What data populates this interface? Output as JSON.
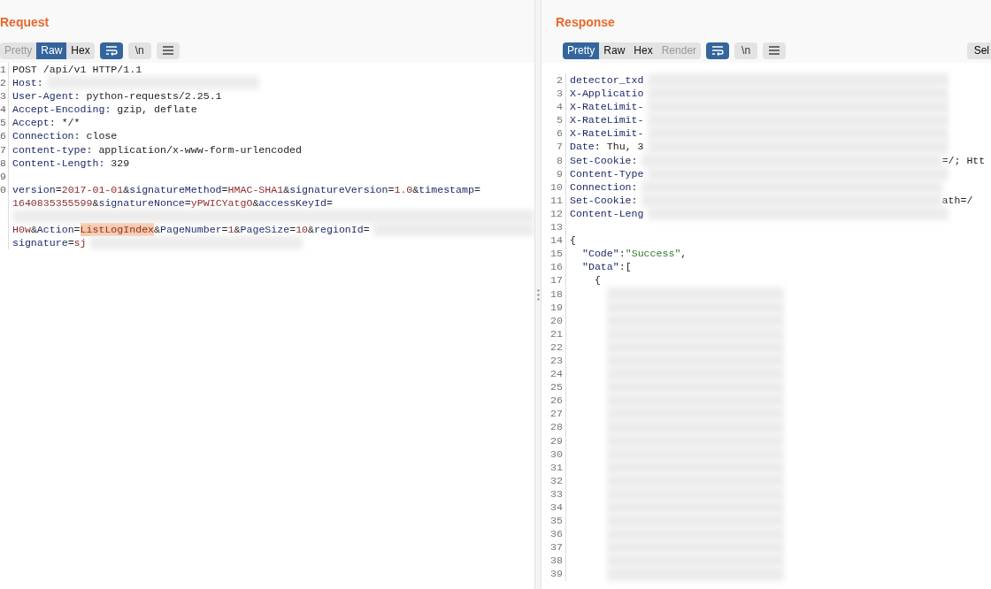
{
  "request": {
    "title": "Request",
    "views": [
      {
        "label": "Pretty",
        "selected": false,
        "disabled": true
      },
      {
        "label": "Raw",
        "selected": true,
        "disabled": false
      },
      {
        "label": "Hex",
        "selected": false,
        "disabled": false
      }
    ],
    "wrap": {
      "on": true
    },
    "newline_label": "\\n",
    "lines": [
      {
        "number": "1",
        "segments": [
          {
            "kind": "plain",
            "text": "POST /api/v1 HTTP/1.1"
          }
        ]
      },
      {
        "number": "2",
        "segments": [
          {
            "kind": "key",
            "text": "Host"
          },
          {
            "kind": "plain",
            "text": ":"
          },
          {
            "kind": "redacted"
          }
        ]
      },
      {
        "number": "3",
        "segments": [
          {
            "kind": "key",
            "text": "User-Agent"
          },
          {
            "kind": "plain",
            "text": ": python-requests/2.25.1"
          }
        ]
      },
      {
        "number": "4",
        "segments": [
          {
            "kind": "key",
            "text": "Accept-Encoding"
          },
          {
            "kind": "plain",
            "text": ": gzip, deflate"
          }
        ]
      },
      {
        "number": "5",
        "segments": [
          {
            "kind": "key",
            "text": "Accept"
          },
          {
            "kind": "plain",
            "text": ": */*"
          }
        ]
      },
      {
        "number": "6",
        "segments": [
          {
            "kind": "key",
            "text": "Connection"
          },
          {
            "kind": "plain",
            "text": ": close"
          }
        ]
      },
      {
        "number": "7",
        "segments": [
          {
            "kind": "key",
            "text": "content-type"
          },
          {
            "kind": "plain",
            "text": ": application/x-www-form-urlencoded"
          }
        ]
      },
      {
        "number": "8",
        "segments": [
          {
            "kind": "key",
            "text": "Content-Length"
          },
          {
            "kind": "plain",
            "text": ": 329"
          }
        ]
      },
      {
        "number": "9"
      },
      {
        "number": "0",
        "segments": [
          {
            "kind": "key",
            "text": "version"
          },
          {
            "kind": "plain",
            "text": "="
          },
          {
            "kind": "value",
            "text": "2017-01-01"
          },
          {
            "kind": "plain",
            "text": "&"
          },
          {
            "kind": "key",
            "text": "signatureMethod"
          },
          {
            "kind": "plain",
            "text": "="
          },
          {
            "kind": "value",
            "text": "HMAC-SHA1"
          },
          {
            "kind": "plain",
            "text": "&"
          },
          {
            "kind": "key",
            "text": "signatureVersion"
          },
          {
            "kind": "plain",
            "text": "="
          },
          {
            "kind": "value",
            "text": "1.0"
          },
          {
            "kind": "plain",
            "text": "&"
          },
          {
            "kind": "key",
            "text": "timestamp"
          },
          {
            "kind": "plain",
            "text": "="
          },
          {
            "kind": "wrap"
          },
          {
            "kind": "value",
            "text": "1640835355599"
          },
          {
            "kind": "plain",
            "text": "&"
          },
          {
            "kind": "key",
            "text": "signatureNonce"
          },
          {
            "kind": "plain",
            "text": "="
          },
          {
            "kind": "value",
            "text": "yPWICYatgO"
          },
          {
            "kind": "plain",
            "text": "&"
          },
          {
            "kind": "key",
            "text": "accessKeyId"
          },
          {
            "kind": "plain",
            "text": "="
          },
          {
            "kind": "wrap"
          },
          {
            "kind": "redacted"
          },
          {
            "kind": "wrap"
          },
          {
            "kind": "value",
            "text": "H0w"
          },
          {
            "kind": "plain",
            "text": "&"
          },
          {
            "kind": "key",
            "text": "Action"
          },
          {
            "kind": "plain",
            "text": "="
          },
          {
            "kind": "highlight",
            "text": "ListLogIndex"
          },
          {
            "kind": "plain",
            "text": "&"
          },
          {
            "kind": "key",
            "text": "PageNumber"
          },
          {
            "kind": "plain",
            "text": "="
          },
          {
            "kind": "value",
            "text": "1"
          },
          {
            "kind": "plain",
            "text": "&"
          },
          {
            "kind": "key",
            "text": "PageSize"
          },
          {
            "kind": "plain",
            "text": "="
          },
          {
            "kind": "value",
            "text": "10"
          },
          {
            "kind": "plain",
            "text": "&"
          },
          {
            "kind": "key",
            "text": "regionId"
          },
          {
            "kind": "plain",
            "text": "="
          },
          {
            "kind": "redacted"
          },
          {
            "kind": "wrap"
          },
          {
            "kind": "key",
            "text": "signature"
          },
          {
            "kind": "plain",
            "text": "="
          },
          {
            "kind": "value",
            "text": "sj"
          },
          {
            "kind": "redacted"
          }
        ]
      }
    ]
  },
  "response": {
    "title": "Response",
    "views": [
      {
        "label": "Pretty",
        "selected": true,
        "disabled": false
      },
      {
        "label": "Raw",
        "selected": false,
        "disabled": false
      },
      {
        "label": "Hex",
        "selected": false,
        "disabled": false
      },
      {
        "label": "Render",
        "selected": false,
        "disabled": true
      }
    ],
    "wrap": {
      "on": true
    },
    "newline_label": "\\n",
    "select_label": "Sel",
    "lines": [
      {
        "number": "2",
        "segments": [
          {
            "kind": "key",
            "text": "detector_txd"
          },
          {
            "kind": "redacted"
          }
        ]
      },
      {
        "number": "3",
        "segments": [
          {
            "kind": "key",
            "text": "X-Applicatio"
          },
          {
            "kind": "redacted"
          }
        ]
      },
      {
        "number": "4",
        "segments": [
          {
            "kind": "key",
            "text": "X-RateLimit-"
          },
          {
            "kind": "redacted"
          }
        ]
      },
      {
        "number": "5",
        "segments": [
          {
            "kind": "key",
            "text": "X-RateLimit-"
          },
          {
            "kind": "redacted"
          }
        ]
      },
      {
        "number": "6",
        "segments": [
          {
            "kind": "key",
            "text": "X-RateLimit-"
          },
          {
            "kind": "redacted"
          }
        ]
      },
      {
        "number": "7",
        "segments": [
          {
            "kind": "key",
            "text": "Date"
          },
          {
            "kind": "plain",
            "text": ": Thu, 3"
          },
          {
            "kind": "redacted"
          }
        ]
      },
      {
        "number": "8",
        "segments": [
          {
            "kind": "key",
            "text": "Set-Cookie"
          },
          {
            "kind": "plain",
            "text": ":"
          },
          {
            "kind": "redacted"
          },
          {
            "kind": "plain",
            "text": "=/; Htt"
          }
        ]
      },
      {
        "number": "9",
        "segments": [
          {
            "kind": "key",
            "text": "Content-Type"
          },
          {
            "kind": "redacted"
          }
        ]
      },
      {
        "number": "10",
        "segments": [
          {
            "kind": "key",
            "text": "Connection"
          },
          {
            "kind": "plain",
            "text": ":"
          },
          {
            "kind": "redacted"
          }
        ]
      },
      {
        "number": "11",
        "segments": [
          {
            "kind": "key",
            "text": "Set-Cookie"
          },
          {
            "kind": "plain",
            "text": ":"
          },
          {
            "kind": "redacted"
          },
          {
            "kind": "plain",
            "text": "ath=/"
          }
        ]
      },
      {
        "number": "12",
        "segments": [
          {
            "kind": "key",
            "text": "Content-Leng"
          },
          {
            "kind": "redacted"
          }
        ]
      },
      {
        "number": "13"
      },
      {
        "number": "14",
        "segments": [
          {
            "kind": "plain",
            "text": "{"
          }
        ]
      },
      {
        "number": "15",
        "segments": [
          {
            "kind": "indent"
          },
          {
            "kind": "key",
            "text": "\"Code\""
          },
          {
            "kind": "plain",
            "text": ":"
          },
          {
            "kind": "string",
            "text": "\"Success\""
          },
          {
            "kind": "plain",
            "text": ","
          }
        ]
      },
      {
        "number": "16",
        "segments": [
          {
            "kind": "indent"
          },
          {
            "kind": "key",
            "text": "\"Data\""
          },
          {
            "kind": "plain",
            "text": ":["
          }
        ]
      },
      {
        "number": "17",
        "segments": [
          {
            "kind": "indent"
          },
          {
            "kind": "indent"
          },
          {
            "kind": "plain",
            "text": "{"
          }
        ]
      },
      {
        "number": "18",
        "segments": [
          {
            "kind": "indent"
          },
          {
            "kind": "indent"
          },
          {
            "kind": "indent"
          },
          {
            "kind": "redacted"
          }
        ]
      },
      {
        "number": "19",
        "segments": [
          {
            "kind": "indent"
          },
          {
            "kind": "indent"
          },
          {
            "kind": "indent"
          },
          {
            "kind": "redacted"
          }
        ]
      },
      {
        "number": "20",
        "segments": [
          {
            "kind": "indent"
          },
          {
            "kind": "indent"
          },
          {
            "kind": "indent"
          },
          {
            "kind": "redacted"
          }
        ]
      },
      {
        "number": "21",
        "segments": [
          {
            "kind": "indent"
          },
          {
            "kind": "indent"
          },
          {
            "kind": "indent"
          },
          {
            "kind": "redacted"
          }
        ]
      },
      {
        "number": "22",
        "segments": [
          {
            "kind": "indent"
          },
          {
            "kind": "indent"
          },
          {
            "kind": "indent"
          },
          {
            "kind": "redacted"
          }
        ]
      },
      {
        "number": "23",
        "segments": [
          {
            "kind": "indent"
          },
          {
            "kind": "indent"
          },
          {
            "kind": "indent"
          },
          {
            "kind": "redacted"
          }
        ]
      },
      {
        "number": "24",
        "segments": [
          {
            "kind": "indent"
          },
          {
            "kind": "indent"
          },
          {
            "kind": "indent"
          },
          {
            "kind": "redacted"
          }
        ]
      },
      {
        "number": "25",
        "segments": [
          {
            "kind": "indent"
          },
          {
            "kind": "indent"
          },
          {
            "kind": "indent"
          },
          {
            "kind": "redacted"
          }
        ]
      },
      {
        "number": "26",
        "segments": [
          {
            "kind": "indent"
          },
          {
            "kind": "indent"
          },
          {
            "kind": "indent"
          },
          {
            "kind": "redacted"
          }
        ]
      },
      {
        "number": "27",
        "segments": [
          {
            "kind": "indent"
          },
          {
            "kind": "indent"
          },
          {
            "kind": "indent"
          },
          {
            "kind": "redacted"
          }
        ]
      },
      {
        "number": "28",
        "segments": [
          {
            "kind": "indent"
          },
          {
            "kind": "indent"
          },
          {
            "kind": "indent"
          },
          {
            "kind": "redacted"
          }
        ]
      },
      {
        "number": "29",
        "segments": [
          {
            "kind": "indent"
          },
          {
            "kind": "indent"
          },
          {
            "kind": "indent"
          },
          {
            "kind": "redacted"
          }
        ]
      },
      {
        "number": "30",
        "segments": [
          {
            "kind": "indent"
          },
          {
            "kind": "indent"
          },
          {
            "kind": "indent"
          },
          {
            "kind": "redacted"
          }
        ]
      },
      {
        "number": "31",
        "segments": [
          {
            "kind": "indent"
          },
          {
            "kind": "indent"
          },
          {
            "kind": "indent"
          },
          {
            "kind": "redacted"
          }
        ]
      },
      {
        "number": "32",
        "segments": [
          {
            "kind": "indent"
          },
          {
            "kind": "indent"
          },
          {
            "kind": "indent"
          },
          {
            "kind": "redacted"
          }
        ]
      },
      {
        "number": "33",
        "segments": [
          {
            "kind": "indent"
          },
          {
            "kind": "indent"
          },
          {
            "kind": "indent"
          },
          {
            "kind": "redacted"
          }
        ]
      },
      {
        "number": "34",
        "segments": [
          {
            "kind": "indent"
          },
          {
            "kind": "indent"
          },
          {
            "kind": "indent"
          },
          {
            "kind": "redacted"
          }
        ]
      },
      {
        "number": "35",
        "segments": [
          {
            "kind": "indent"
          },
          {
            "kind": "indent"
          },
          {
            "kind": "indent"
          },
          {
            "kind": "redacted"
          }
        ]
      },
      {
        "number": "36",
        "segments": [
          {
            "kind": "indent"
          },
          {
            "kind": "indent"
          },
          {
            "kind": "indent"
          },
          {
            "kind": "redacted"
          }
        ]
      },
      {
        "number": "37",
        "segments": [
          {
            "kind": "indent"
          },
          {
            "kind": "indent"
          },
          {
            "kind": "indent"
          },
          {
            "kind": "redacted"
          }
        ]
      },
      {
        "number": "38",
        "segments": [
          {
            "kind": "indent"
          },
          {
            "kind": "indent"
          },
          {
            "kind": "indent"
          },
          {
            "kind": "redacted"
          }
        ]
      },
      {
        "number": "39",
        "segments": [
          {
            "kind": "indent"
          },
          {
            "kind": "indent"
          },
          {
            "kind": "indent"
          },
          {
            "kind": "redacted"
          }
        ]
      }
    ]
  }
}
